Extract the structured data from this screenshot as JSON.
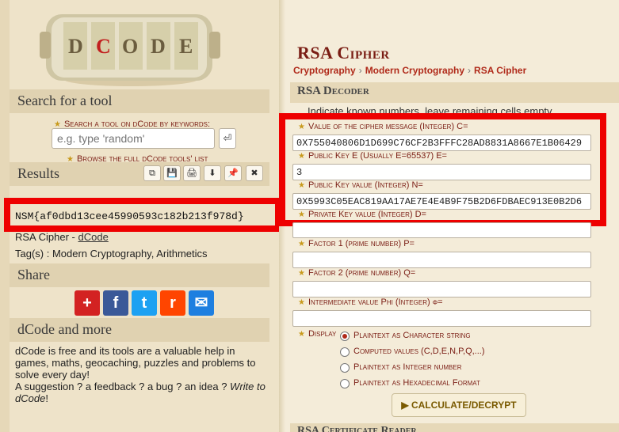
{
  "logo": {
    "letters": [
      "D",
      "C",
      "O",
      "D",
      "E"
    ]
  },
  "sidebar": {
    "search_title": "Search for a tool",
    "search_label": "Search a tool on dCode by keywords:",
    "search_placeholder": "e.g. type 'random'",
    "search_go": "⏎",
    "browse_prefix": "Browse the ",
    "browse_link": "full dCode tools' list",
    "results_title": "Results",
    "results_tools": [
      "⧉",
      "💾",
      "🖨",
      "⬇",
      "📌",
      "✖"
    ],
    "result_value": "NSM{af0dbd13cee45990593c182b213f978d}",
    "result_source_prefix": "RSA Cipher - ",
    "result_source_link": "dCode",
    "tags": "Tag(s) : Modern Cryptography, Arithmetics",
    "share_title": "Share",
    "share_buttons": [
      {
        "icon": "plus-icon",
        "glyph": "+",
        "color": "#d32222"
      },
      {
        "icon": "facebook-icon",
        "glyph": "f",
        "color": "#3b5998"
      },
      {
        "icon": "twitter-icon",
        "glyph": "t",
        "color": "#1da1f2"
      },
      {
        "icon": "reddit-icon",
        "glyph": "r",
        "color": "#ff4500"
      },
      {
        "icon": "email-icon",
        "glyph": "✉",
        "color": "#1e7fe0"
      }
    ],
    "more_title": "dCode and more",
    "more_text": "dCode is free and its tools are a valuable help in games, maths, geocaching, puzzles and problems to solve every day!",
    "more_line2_prefix": "A suggestion ? a feedback ? a bug ? an idea ? ",
    "more_line2_link": "Write to dCode",
    "more_line2_suffix": "!"
  },
  "main": {
    "title": "RSA Cipher",
    "breadcrumb": [
      "Cryptography",
      "Modern Cryptography",
      "RSA Cipher"
    ],
    "decoder_title": "RSA Decoder",
    "hint": "Indicate known numbers, leave remaining cells empty.",
    "fields": [
      {
        "label": "Value of the cipher message (Integer) C=",
        "value": "0X755040806D1D699C76CF2B3FFFC28AD8831A8667E1B06429"
      },
      {
        "label": "Public Key E (Usually E=65537) E=",
        "value": "3"
      },
      {
        "label": "Public Key value (Integer) N=",
        "value": "0X5993C05EAC819AA17AE7E4E4B9F75B2D6FDBAEC913E0B2D6"
      },
      {
        "label": "Private Key value (Integer) D=",
        "value": ""
      },
      {
        "label": "Factor 1 (prime number) P=",
        "value": ""
      },
      {
        "label": "Factor 2 (prime number) Q=",
        "value": ""
      },
      {
        "label": "Intermediate value Phi (Integer) φ=",
        "value": ""
      }
    ],
    "display_label": "Display",
    "display_options": [
      {
        "label": "Plaintext as Character string",
        "checked": true
      },
      {
        "label": "Computed values (C,D,E,N,P,Q,...)",
        "checked": false
      },
      {
        "label": "Plaintext as Integer number",
        "checked": false
      },
      {
        "label": "Plaintext as Hexadecimal Format",
        "checked": false
      }
    ],
    "calculate_button": "▶ CALCULATE/DECRYPT",
    "next_section_title": "RSA Certificate Reader"
  },
  "colors": {
    "highlight": "#ee0000",
    "accent": "#7a1d14",
    "link": "#b02a1a"
  }
}
